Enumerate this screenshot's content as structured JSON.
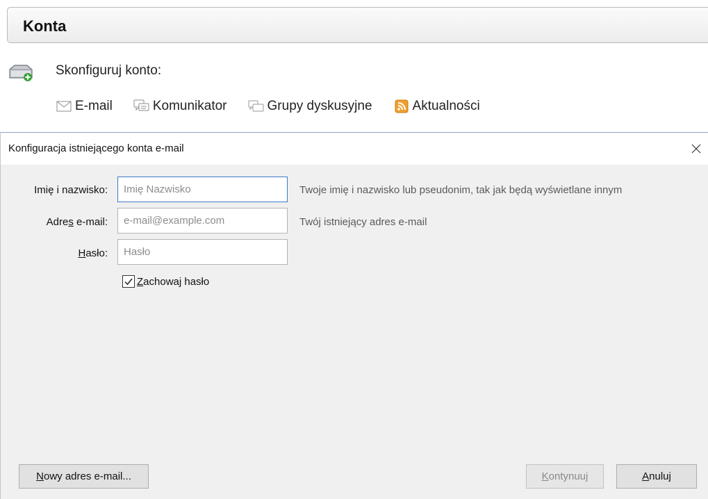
{
  "page": {
    "title": "Konta",
    "setup_label": "Skonfiguruj konto:",
    "setup_links": [
      {
        "label": "E-mail",
        "icon": "envelope-icon"
      },
      {
        "label": "Komunikator",
        "icon": "chat-icon"
      },
      {
        "label": "Grupy dyskusyjne",
        "icon": "newsgroup-icon"
      },
      {
        "label": "Aktualności",
        "icon": "rss-feed-icon"
      }
    ]
  },
  "dialog": {
    "title": "Konfiguracja istniejącego konta e-mail",
    "close_icon": "close-icon",
    "fields": {
      "name": {
        "label_pre": "Imię i nazwisko:",
        "value": "",
        "placeholder": "Imię Nazwisko",
        "hint": "Twoje imię i nazwisko lub pseudonim, tak jak będą wyświetlane innym"
      },
      "email": {
        "label_pre": "Adre",
        "label_accel": "s",
        "label_post": " e-mail:",
        "value": "",
        "placeholder": "e-mail@example.com",
        "hint": "Twój istniejący adres e-mail"
      },
      "password": {
        "label_accel": "H",
        "label_post": "asło:",
        "value": "",
        "placeholder": "Hasło"
      }
    },
    "remember_password": {
      "accel": "Z",
      "label_post": "achowaj hasło",
      "checked": true
    },
    "buttons": {
      "new_address": {
        "accel": "N",
        "label_post": "owy adres e-mail..."
      },
      "continue": {
        "accel": "K",
        "label_post": "ontynuuj",
        "enabled": false
      },
      "cancel": {
        "accel": "A",
        "label_post": "nuluj"
      }
    }
  },
  "colors": {
    "focus_border": "#3c79c8",
    "dialog_background": "#f0f0f0",
    "rss_orange": "#f0a030"
  }
}
